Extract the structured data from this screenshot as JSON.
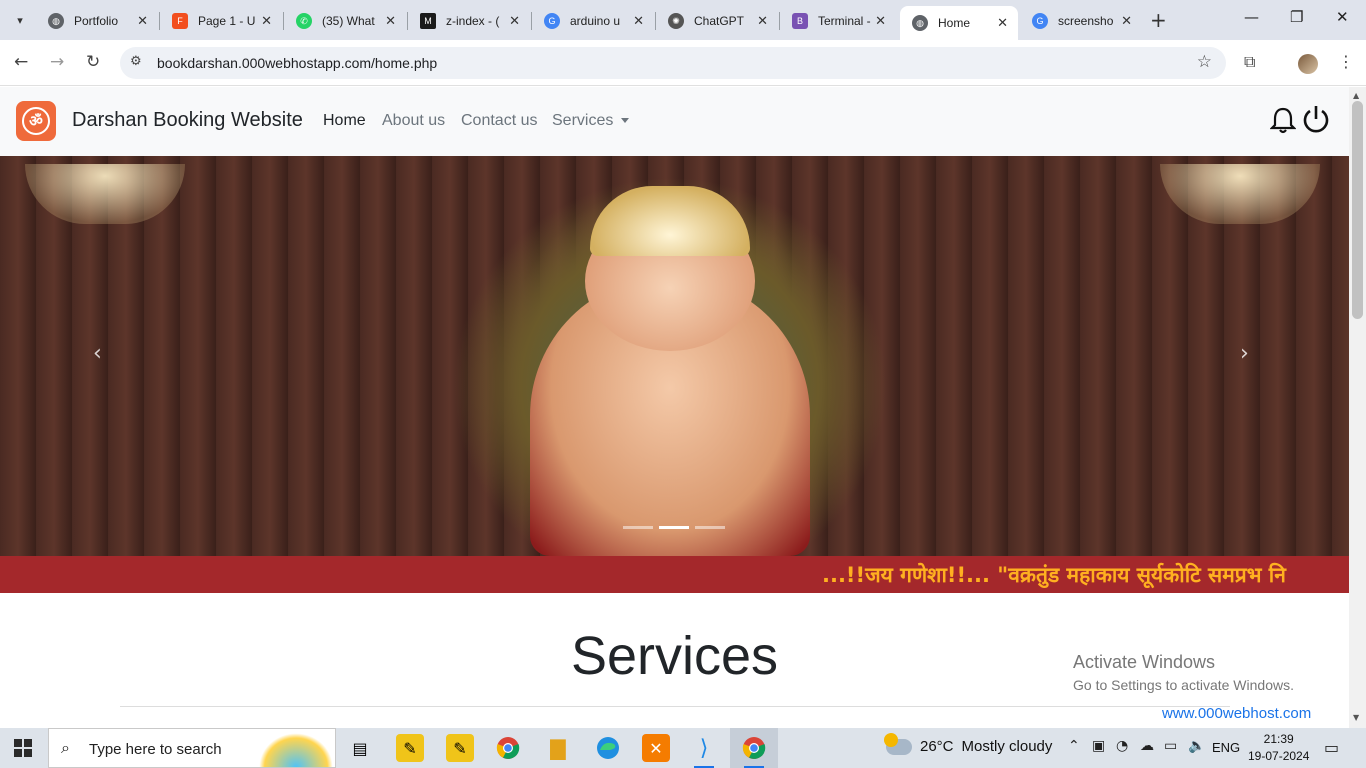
{
  "browser": {
    "tabs": [
      {
        "title": "Portfolio",
        "favicon": "globe-icon",
        "color": "#5f6368",
        "active": false
      },
      {
        "title": "Page 1 - U",
        "favicon": "figma-icon",
        "color": "#f24e1e",
        "active": false
      },
      {
        "title": "(35) What",
        "favicon": "whatsapp-icon",
        "color": "#25d366",
        "active": false
      },
      {
        "title": "z-index - (",
        "favicon": "mdn-icon",
        "color": "#1b1b1b",
        "active": false
      },
      {
        "title": "arduino u",
        "favicon": "google-icon",
        "color": "#4285f4",
        "active": false
      },
      {
        "title": "ChatGPT",
        "favicon": "chatgpt-icon",
        "color": "#555555",
        "active": false
      },
      {
        "title": "Terminal -",
        "favicon": "bootstrap-icon",
        "color": "#7952b3",
        "active": false
      },
      {
        "title": "Home",
        "favicon": "globe-icon",
        "color": "#5f6368",
        "active": true
      },
      {
        "title": "screensho",
        "favicon": "google-icon",
        "color": "#4285f4",
        "active": false
      }
    ],
    "url": "bookdarshan.000webhostapp.com/home.php"
  },
  "site": {
    "brand": "Darshan Booking Website",
    "nav": [
      {
        "label": "Home",
        "active": true
      },
      {
        "label": "About us",
        "active": false
      },
      {
        "label": "Contact us",
        "active": false
      },
      {
        "label": "Services",
        "active": false,
        "dropdown": true
      }
    ],
    "carousel": {
      "slides": 3,
      "active_slide": 2
    },
    "marquee": "...!!जय गणेशा!!... \"वक्रतुंड महाकाय सूर्यकोटि समप्रभ नि",
    "services_title": "Services",
    "host_badge": "www.000webhost.com"
  },
  "watermark": {
    "line1": "Activate Windows",
    "line2": "Go to Settings to activate Windows."
  },
  "taskbar": {
    "search_placeholder": "Type here to search",
    "weather_temp": "26°C",
    "weather_text": "Mostly cloudy",
    "language": "ENG",
    "time": "21:39",
    "date": "19-07-2024"
  }
}
